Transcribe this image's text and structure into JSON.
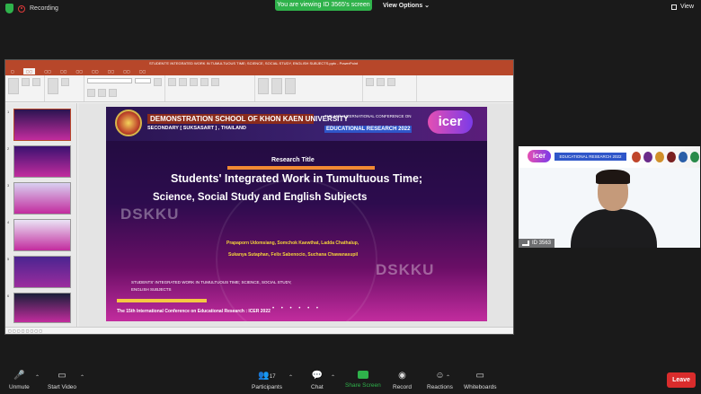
{
  "top_bar": {
    "recording_label": "Recording",
    "viewing_label": "You are viewing ID 3565's screen",
    "view_options_label": "View Options",
    "view_label": "View"
  },
  "shared_screen": {
    "ppt_window_title": "STUDENTS' INTEGRATED WORK IN TUMULTUOUS TIME; SCIENCE, SOCIAL STUDY, ENGLISH SUBJECTS.pptx - PowerPoint",
    "slide_numbers": [
      "1",
      "2",
      "3",
      "4",
      "5",
      "6"
    ],
    "slide": {
      "school_name": "DEMONSTRATION SCHOOL OF KHON KAEN UNIVERSITY",
      "school_sub": "SECONDARY [ SUKSASART ] , THAILAND",
      "conf_top": "THE 15th INTERNATIONAL CONFERENCE ON",
      "conf_main": "EDUCATIONAL RESEARCH 2022",
      "icer_logo": "icer",
      "research_title_label": "Research Title",
      "title_line1": "Students' Integrated Work in Tumultuous Time;",
      "title_line2": "Science, Social Study and English Subjects",
      "watermark": "DSKKU",
      "authors_line1": "Prapaporn Udomsiang, Somchok Kaewthat, Ladda Chathalup,",
      "authors_line2": "Sukanya Sutaphan, Felix Sabenocio, Suchana Chawanasupil",
      "sub_text": "STUDENTS' INTEGRATED WORK IN TUMULTUOUS TIME; SCIENCE, SOCIAL STUDY, ENGLISH SUBJECTS",
      "footer_text": "The 15th International Conference on Educational Research : ICER 2022"
    }
  },
  "video_tile": {
    "participant_label": "ID 3563",
    "banner_icer": "icer",
    "banner_conf": "EDUCATIONAL RESEARCH 2022"
  },
  "toolbar": {
    "unmute": "Unmute",
    "start_video": "Start Video",
    "participants": "Participants",
    "participants_count": "17",
    "chat": "Chat",
    "share_screen": "Share Screen",
    "record": "Record",
    "reactions": "Reactions",
    "whiteboards": "Whiteboards",
    "leave": "Leave"
  },
  "colors": {
    "accent_green": "#2fb24b",
    "leave_red": "#d92c2c",
    "ppt_red": "#b7472a"
  }
}
